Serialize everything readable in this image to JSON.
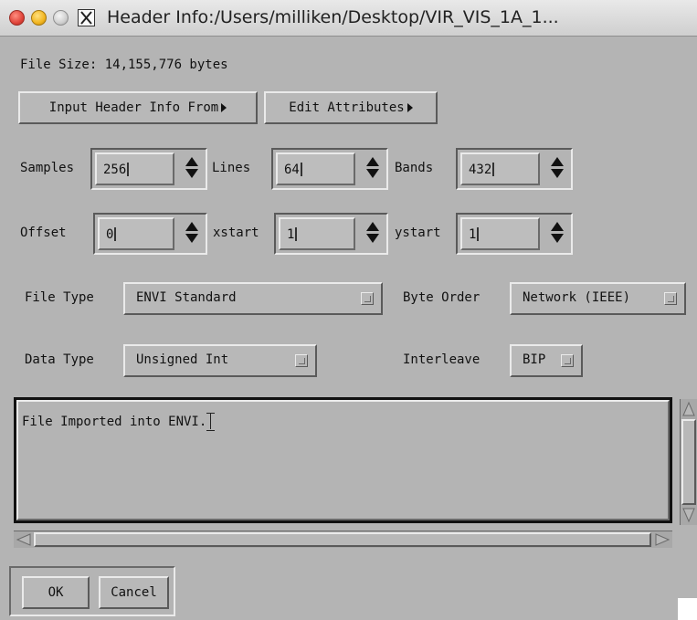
{
  "window": {
    "title": "Header Info:/Users/milliken/Desktop/VIR_VIS_1A_1..."
  },
  "file_size": "File Size: 14,155,776 bytes",
  "buttons": {
    "input_header": "Input Header Info From",
    "edit_attributes": "Edit Attributes",
    "ok": "OK",
    "cancel": "Cancel"
  },
  "fields": {
    "samples": {
      "label": "Samples",
      "value": "256"
    },
    "lines": {
      "label": "Lines",
      "value": "64"
    },
    "bands": {
      "label": "Bands",
      "value": "432"
    },
    "offset": {
      "label": "Offset",
      "value": "0"
    },
    "xstart": {
      "label": "xstart",
      "value": "1"
    },
    "ystart": {
      "label": "ystart",
      "value": "1"
    }
  },
  "dropdowns": {
    "file_type": {
      "label": "File Type",
      "value": "ENVI Standard"
    },
    "byte_order": {
      "label": "Byte Order",
      "value": "Network (IEEE)"
    },
    "data_type": {
      "label": "Data Type",
      "value": "Unsigned Int"
    },
    "interleave": {
      "label": "Interleave",
      "value": "BIP"
    }
  },
  "description": "File Imported into ENVI.",
  "colors": {
    "panel": "#b4b4b4",
    "close": "#e0443a",
    "minimize": "#f2b51f",
    "zoom": "#cfcfcf"
  }
}
